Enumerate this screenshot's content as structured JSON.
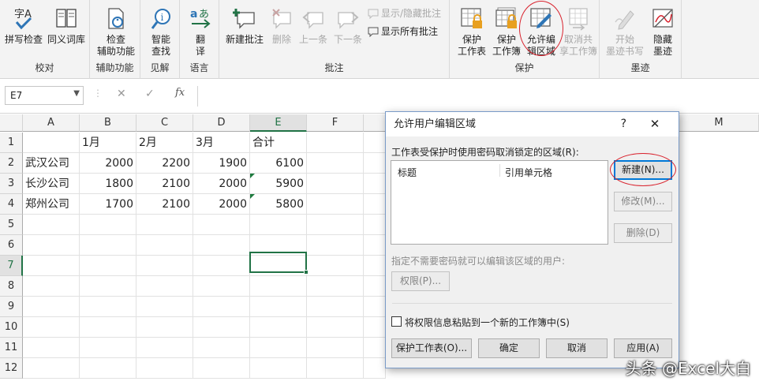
{
  "ribbon": {
    "proofing": {
      "spelling": "拼写检查",
      "thesaurus": "同义词库",
      "label": "校对",
      "spelling_glyph": "字A"
    },
    "accessibility": {
      "check_line1": "检查",
      "check_line2": "辅助功能",
      "label": "辅助功能"
    },
    "insights": {
      "smart_line1": "智能",
      "smart_line2": "查找",
      "label": "见解"
    },
    "language": {
      "translate_line1": "翻",
      "translate_line2": "译",
      "label": "语言"
    },
    "comments": {
      "new": "新建批注",
      "delete": "删除",
      "previous": "上一条",
      "next": "下一条",
      "show_hide": "显示/隐藏批注",
      "show_all": "显示所有批注",
      "label": "批注"
    },
    "protect": {
      "sheet_line1": "保护",
      "sheet_line2": "工作表",
      "workbook_line1": "保护",
      "workbook_line2": "工作簿",
      "allow_line1": "允许编",
      "allow_line2": "辑区域",
      "unshare_line1": "取消共",
      "unshare_line2": "享工作簿",
      "label": "保护"
    },
    "ink": {
      "start_line1": "开始",
      "start_line2": "墨迹书写",
      "hide_line1": "隐藏",
      "hide_line2": "墨迹",
      "label": "墨迹"
    }
  },
  "formula_bar": {
    "name_box": "E7",
    "fx": "fx",
    "formula": ""
  },
  "sheet": {
    "columns": [
      "A",
      "B",
      "C",
      "D",
      "E",
      "F",
      "M"
    ],
    "rows": [
      "1",
      "2",
      "3",
      "4",
      "5",
      "6",
      "7",
      "8",
      "9",
      "10",
      "11",
      "12"
    ],
    "header_row": [
      "",
      "1月",
      "2月",
      "3月",
      "合计"
    ],
    "data": [
      {
        "name": "武汉公司",
        "m1": "2000",
        "m2": "2200",
        "m3": "1900",
        "total": "6100"
      },
      {
        "name": "长沙公司",
        "m1": "1800",
        "m2": "2100",
        "m3": "2000",
        "total": "5900"
      },
      {
        "name": "郑州公司",
        "m1": "1700",
        "m2": "2100",
        "m3": "2000",
        "total": "5800"
      }
    ],
    "active_cell": "E7"
  },
  "dialog": {
    "title": "允许用户编辑区域",
    "help": "?",
    "close": "✕",
    "ranges_label": "工作表受保护时使用密码取消锁定的区域(R):",
    "col_title": "标题",
    "col_ref": "引用单元格",
    "new_btn": "新建(N)...",
    "modify_btn": "修改(M)...",
    "delete_btn": "删除(D)",
    "users_label": "指定不需要密码就可以编辑该区域的用户:",
    "permissions_btn": "权限(P)...",
    "paste_checkbox": "将权限信息粘贴到一个新的工作簿中(S)",
    "protect_sheet_btn": "保护工作表(O)...",
    "ok_btn": "确定",
    "cancel_btn": "取消",
    "apply_btn": "应用(A)"
  },
  "watermark": "头条 @Excel大白",
  "colors": {
    "excel_green": "#217346",
    "highlight_red": "#d9232e",
    "focus_blue": "#0078d7"
  }
}
